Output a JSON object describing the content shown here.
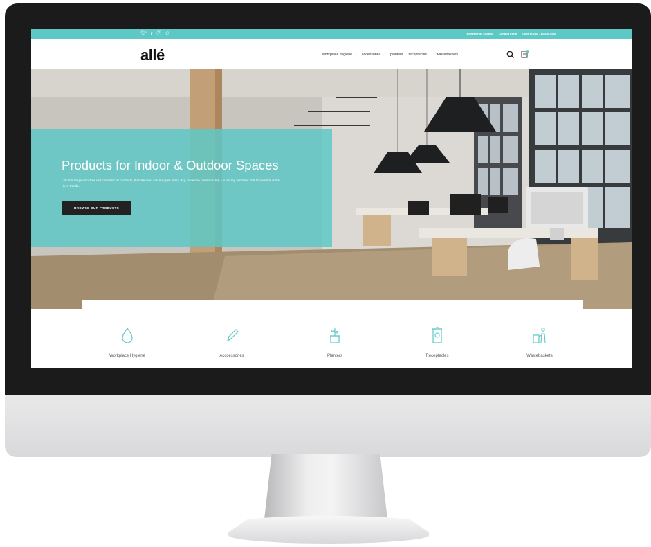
{
  "topbar": {
    "social_icons": [
      "twitter-icon",
      "facebook-icon",
      "pinterest-icon",
      "instagram-icon"
    ],
    "links": [
      "Browse Full Catalog",
      "Contact Form",
      "Click to Call 714-446-5538"
    ],
    "color": "#5ec8c6"
  },
  "navbar": {
    "logo": "allé",
    "menu": [
      "workplace hygiene",
      "accessories",
      "planters",
      "receptacles",
      "wastebaskets"
    ],
    "menu_dropdown": [
      true,
      true,
      false,
      true,
      false
    ]
  },
  "hero": {
    "title": "Products for Indoor & Outdoor Spaces",
    "text": "Our full range of office and commercial products, that are used and enjoyed every day, have one commonality – a lasting aesthetic that transcends short-lived trends.",
    "button": "BROWSE OUR PRODUCTS"
  },
  "categories": [
    {
      "label": "Workplace Hygiene",
      "icon": "droplet-icon"
    },
    {
      "label": "Acccessories",
      "icon": "pen-icon"
    },
    {
      "label": "Planters",
      "icon": "planter-icon"
    },
    {
      "label": "Receptacles",
      "icon": "receptacle-icon"
    },
    {
      "label": "Wastebaskets",
      "icon": "wastebasket-icon"
    }
  ],
  "accent_color": "#5ec8c6"
}
